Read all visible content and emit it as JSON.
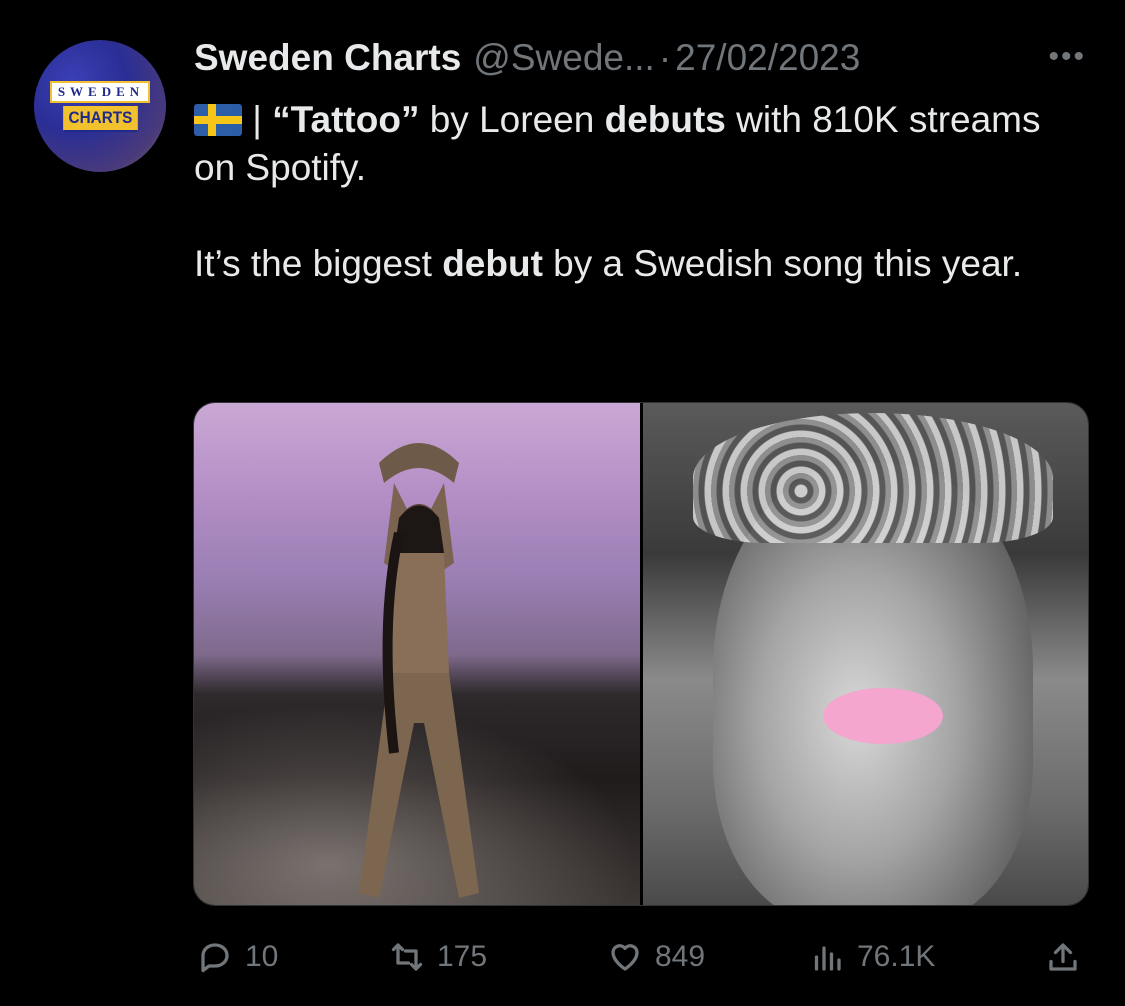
{
  "avatar": {
    "top_text": "SWEDEN",
    "bottom_text": "CHARTS"
  },
  "header": {
    "display_name": "Sweden Charts",
    "handle": "@Swede...",
    "separator": "·",
    "date": "27/02/2023",
    "more_icon": "more-horizontal-icon"
  },
  "tweet": {
    "flag_icon": "sweden-flag-icon",
    "line1_sep": " | ",
    "song": "“Tattoo”",
    "by": " by Loreen ",
    "debuts": "debuts",
    "rest1": " with 810K streams on Spotify.",
    "p2_a": "It’s the biggest ",
    "p2_bold": "debut",
    "p2_b": " by a Swedish song this year."
  },
  "media": [
    {
      "name": "loreen-performance-photo"
    },
    {
      "name": "tattoo-cover-art"
    }
  ],
  "actions": {
    "reply": {
      "icon": "reply-icon",
      "count": "10"
    },
    "retweet": {
      "icon": "retweet-icon",
      "count": "175"
    },
    "like": {
      "icon": "heart-icon",
      "count": "849"
    },
    "views": {
      "icon": "views-chart-icon",
      "count": "76.1K"
    },
    "share": {
      "icon": "share-icon"
    }
  },
  "colors": {
    "background": "#000000",
    "text": "#e7e9ea",
    "muted": "#71767b",
    "flag_blue": "#2b5ea6",
    "flag_yellow": "#f5c518",
    "lips_pink": "#f4a6cf"
  }
}
